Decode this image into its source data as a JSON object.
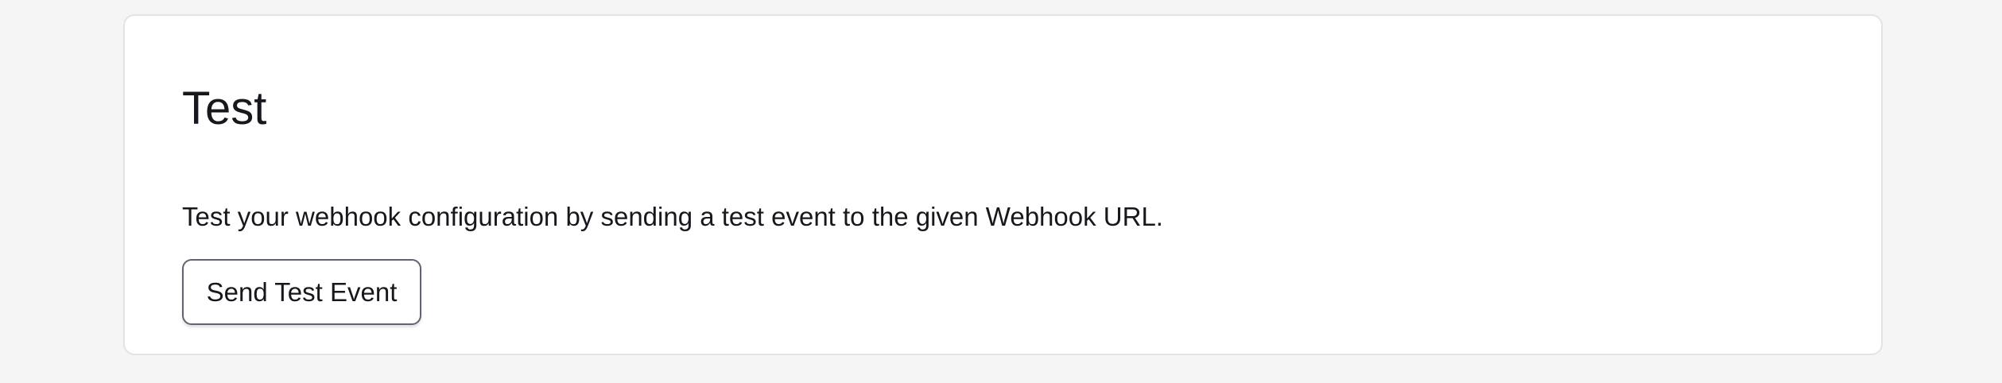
{
  "section": {
    "title": "Test",
    "description": "Test your webhook configuration by sending a test event to the given Webhook URL.",
    "button_label": "Send Test Event"
  },
  "colors": {
    "page_background": "#f5f5f5",
    "card_background": "#ffffff",
    "card_border": "#e2e3e6",
    "text": "#16181d",
    "button_border": "#5f6470"
  }
}
